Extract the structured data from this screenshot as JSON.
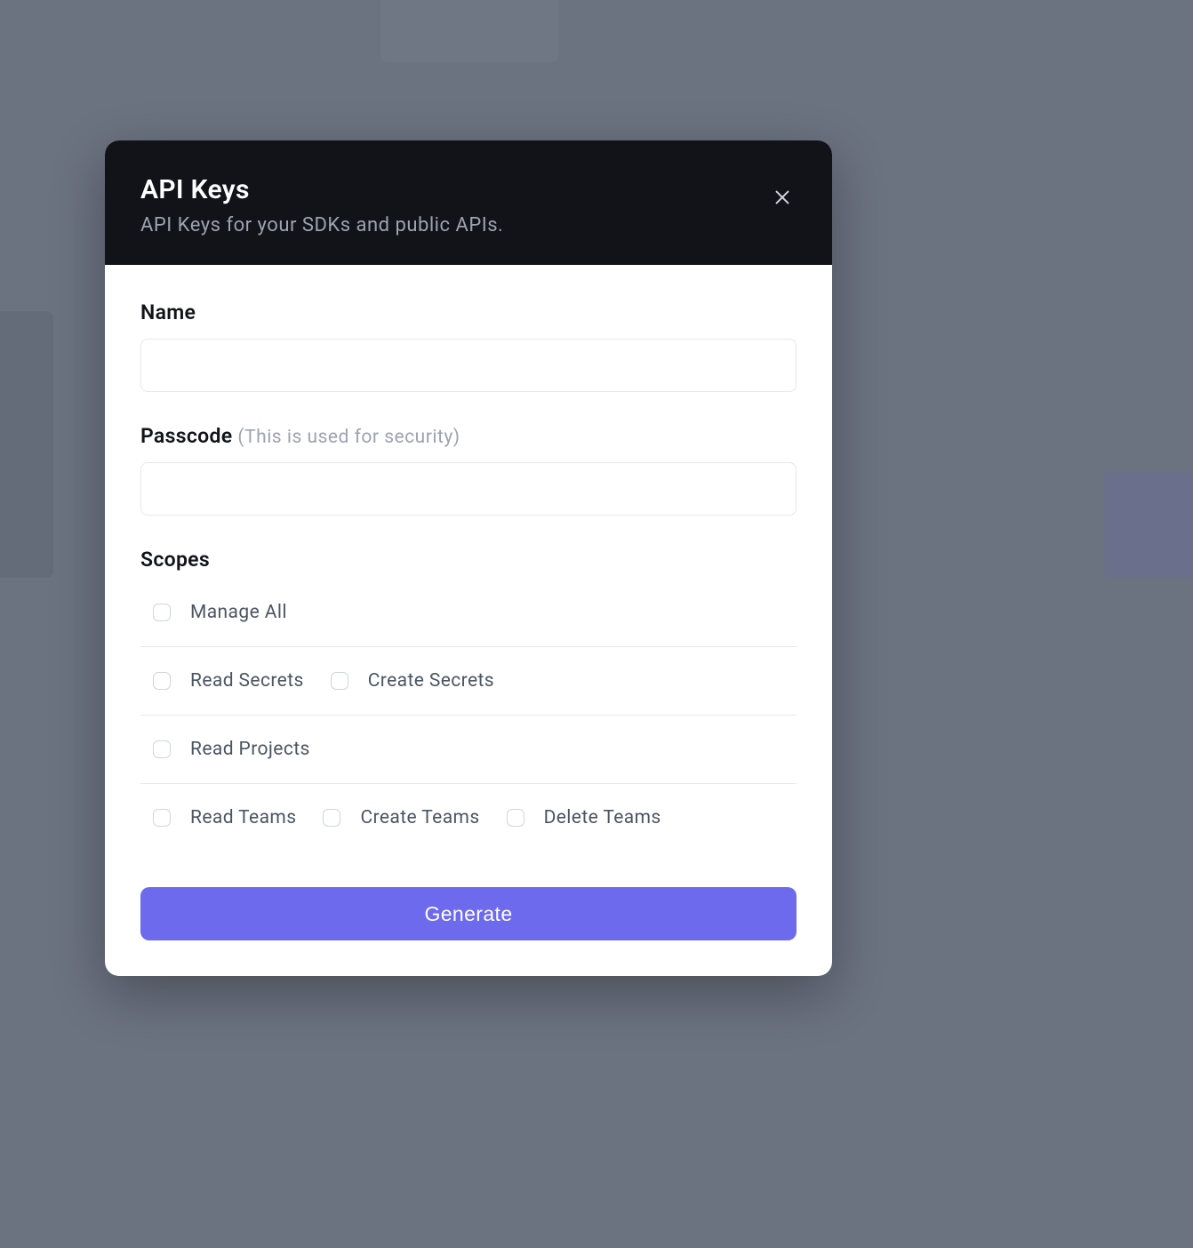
{
  "modal": {
    "title": "API Keys",
    "subtitle": "API Keys for your SDKs and public APIs.",
    "fields": {
      "name": {
        "label": "Name",
        "value": ""
      },
      "passcode": {
        "label": "Passcode",
        "hint": "(This is used for security)",
        "value": ""
      }
    },
    "scopes": {
      "title": "Scopes",
      "rows": [
        [
          {
            "label": "Manage All",
            "checked": false
          }
        ],
        [
          {
            "label": "Read Secrets",
            "checked": false
          },
          {
            "label": "Create Secrets",
            "checked": false
          }
        ],
        [
          {
            "label": "Read Projects",
            "checked": false
          }
        ],
        [
          {
            "label": "Read Teams",
            "checked": false
          },
          {
            "label": "Create Teams",
            "checked": false
          },
          {
            "label": "Delete Teams",
            "checked": false
          }
        ]
      ]
    },
    "generate_label": "Generate"
  }
}
